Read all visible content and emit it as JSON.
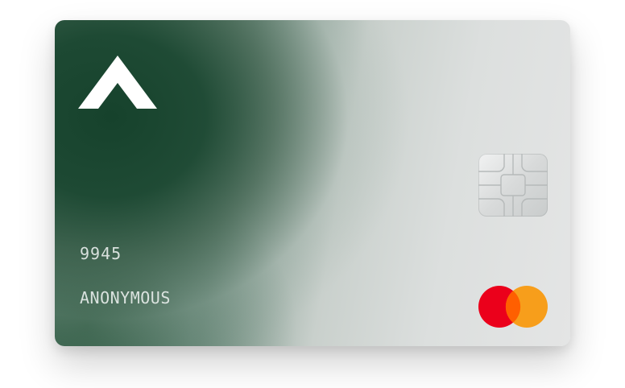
{
  "card": {
    "number_last4": "9945",
    "holder_name": "ANONYMOUS",
    "brand": "mastercard",
    "logo_icon": "chevron-up-logo-icon",
    "chip_icon": "emv-chip-icon"
  },
  "colors": {
    "card_green": "#1c4832",
    "card_silver": "#e4e5e5",
    "mastercard_red": "#eb001b",
    "mastercard_orange": "#f79e1b",
    "mastercard_overlap": "#ff5f00",
    "text": "#e6ece9"
  }
}
